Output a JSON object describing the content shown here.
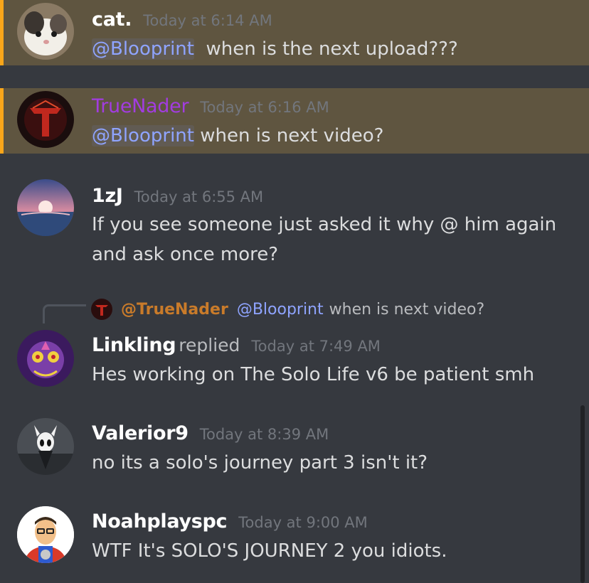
{
  "messages": [
    {
      "user": "cat.",
      "timestamp": "Today at 6:14 AM",
      "mention": "@Blooprint",
      "text": "  when is the next upload???"
    },
    {
      "user": "TrueNader",
      "timestamp": "Today at 6:16 AM",
      "mention": "@Blooprint",
      "text": " when is next video?"
    },
    {
      "user": "1zJ",
      "timestamp": "Today at 6:55 AM",
      "lines": [
        "If you see someone just asked it why @ him again",
        "and ask once more?"
      ]
    },
    {
      "user": "Linkling",
      "replied": "replied",
      "timestamp": "Today at 7:49 AM",
      "text": "Hes working on The Solo Life v6 be patient smh",
      "reply_to": {
        "user": "@TrueNader",
        "mention": "@Blooprint",
        "text": "when is next video?"
      }
    },
    {
      "user": "Valerior9",
      "timestamp": "Today at 8:39 AM",
      "text": "no its a solo's journey part 3 isn't it?"
    },
    {
      "user": "Noahplayspc",
      "timestamp": "Today at 9:00 AM",
      "text": "WTF It's SOLO'S JOURNEY 2 you idiots."
    }
  ],
  "colors": {
    "background": "#36393f",
    "mention_highlight": "#5f5540",
    "mention_bar": "#faa61a",
    "mention_text": "#8fa4ff",
    "truenader": "#a23ce0"
  }
}
